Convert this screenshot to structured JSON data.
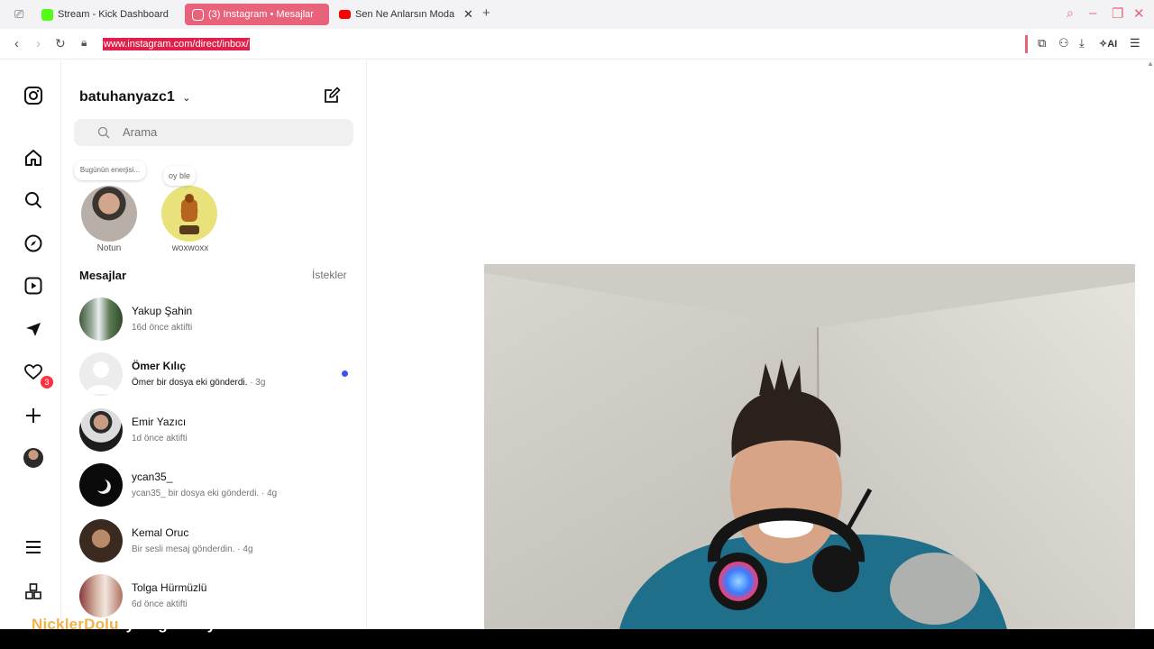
{
  "browser": {
    "tabs": [
      {
        "label": "Stream - Kick Dashboard",
        "icon": "kick-icon",
        "color": "#53fc18"
      },
      {
        "label": "(3) Instagram • Mesajlar",
        "icon": "instagram-icon",
        "color": "#ffffff",
        "active": true
      },
      {
        "label": "Sen Ne Anlarsın Moda",
        "icon": "youtube-icon",
        "color": "#ff0000"
      }
    ],
    "url": "www.instagram.com/direct/inbox/",
    "ai_label": "AI",
    "accent": "#e8637a"
  },
  "rail": {
    "icons": [
      "instagram-logo-icon",
      "home-icon",
      "search-icon",
      "explore-icon",
      "reels-icon",
      "messenger-icon",
      "heart-icon",
      "create-icon",
      "profile-avatar",
      "menu-icon",
      "apps-icon"
    ],
    "messages_badge": "3",
    "badge_color": "#ff3040"
  },
  "inbox": {
    "username": "batuhanyazc1",
    "search_placeholder": "Arama",
    "notes": [
      {
        "note": "Bugünün enerjisi...",
        "name": "Notun"
      },
      {
        "note": "oy ble",
        "name": "woxwoxx"
      }
    ],
    "section_title": "Mesajlar",
    "requests_label": "İstekler",
    "conversations": [
      {
        "name": "Yakup Şahin",
        "subtitle": "16d önce aktifti",
        "time": ""
      },
      {
        "name": "Ömer Kılıç",
        "subtitle": "Ömer bir dosya eki gönderdi.",
        "time": " · 3g",
        "unread": true
      },
      {
        "name": "Emir Yazıcı",
        "subtitle": "1d önce aktifti",
        "time": ""
      },
      {
        "name": "ycan35_",
        "subtitle": "ycan35_ bir dosya eki gönderdi.",
        "time": " · 4g"
      },
      {
        "name": "Kemal Oruc",
        "subtitle": "Bir sesli mesaj gönderdin.",
        "time": " · 4g"
      },
      {
        "name": "Tolga Hürmüzlü",
        "subtitle": "6d önce aktifti",
        "time": ""
      }
    ],
    "unread_color": "#4150f7"
  },
  "overlay": {
    "caption_name": "NicklerDolu",
    "caption_text": "yoo gizleniyoruz sadece"
  }
}
